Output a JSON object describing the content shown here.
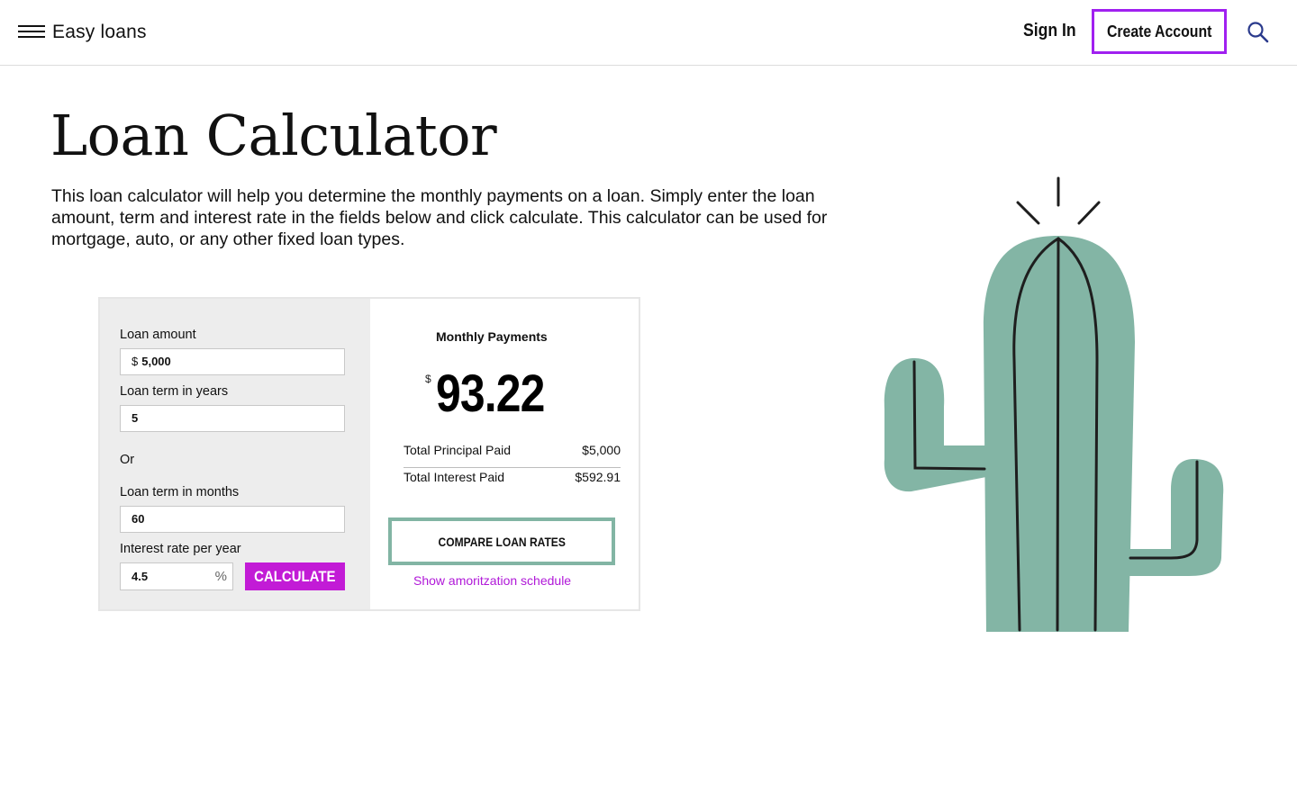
{
  "header": {
    "brand": "Easy loans",
    "sign_in": "Sign In",
    "create_account": "Create Account"
  },
  "page": {
    "title": "Loan Calculator",
    "intro": "This loan calculator will help you determine the monthly payments on a loan. Simply enter the loan amount, term and interest rate in the fields below and click calculate. This calculator can be used for mortgage, auto, or any other fixed loan types."
  },
  "calculator": {
    "loan_amount_label": "Loan amount",
    "loan_amount_prefix": "$",
    "loan_amount_value": "5,000",
    "term_years_label": "Loan term in years",
    "term_years_value": "5",
    "or_label": "Or",
    "term_months_label": "Loan term in months",
    "term_months_value": "60",
    "rate_label": "Interest rate per year",
    "rate_value": "4.5",
    "rate_suffix": "%",
    "calculate_label": "CALCULATE"
  },
  "results": {
    "title": "Monthly Payments",
    "currency": "$",
    "monthly_payment": "93.22",
    "rows": [
      {
        "label": "Total Principal Paid",
        "value": "$5,000"
      },
      {
        "label": "Total Interest Paid",
        "value": "$592.91"
      }
    ],
    "compare_label": "COMPARE LOAN RATES",
    "amortization_link": "Show amoritzation schedule"
  },
  "colors": {
    "accent_purple": "#c21bd6",
    "outline_purple": "#a020f0",
    "teal": "#82b5a4",
    "panel_gray": "#ededed"
  },
  "icons": [
    "menu-icon",
    "search-icon",
    "cactus-illustration"
  ]
}
